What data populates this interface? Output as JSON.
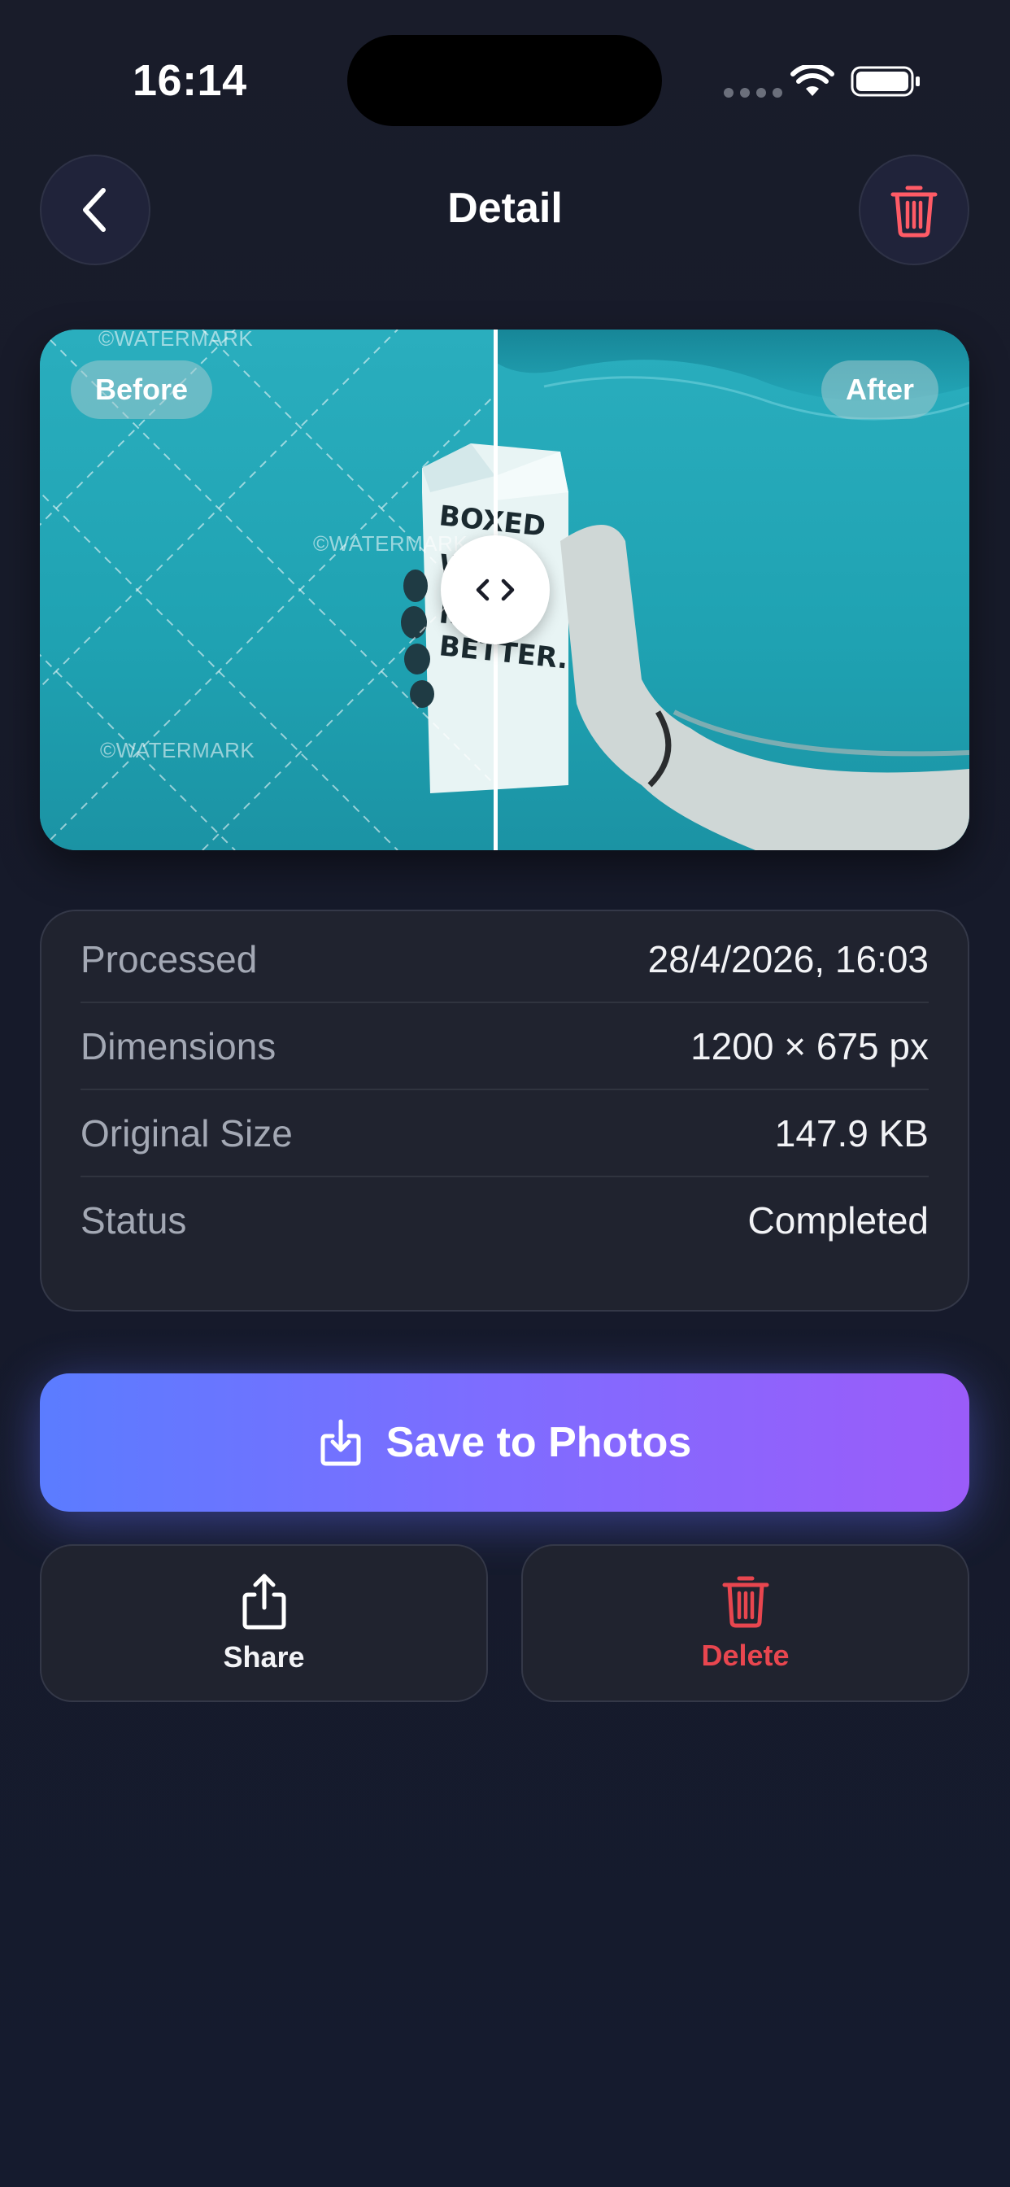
{
  "status_bar": {
    "time": "16:14"
  },
  "header": {
    "title": "Detail",
    "back_icon": "chevron-left-icon",
    "trash_icon": "trash-icon"
  },
  "compare": {
    "before_label": "Before",
    "after_label": "After",
    "watermark": "©WATERMARK",
    "handle_icon": "left-right-arrows-icon",
    "split_fraction": 0.49
  },
  "info": {
    "rows": [
      {
        "label": "Processed",
        "value": "28/4/2026, 16:03"
      },
      {
        "label": "Dimensions",
        "value": "1200 × 675 px"
      },
      {
        "label": "Original Size",
        "value": "147.9 KB"
      },
      {
        "label": "Status",
        "value": "Completed"
      }
    ]
  },
  "actions": {
    "save_label": "Save to Photos",
    "share_label": "Share",
    "delete_label": "Delete"
  },
  "colors": {
    "background": "#181b2a",
    "card": "#20232f",
    "accent_start": "#5b7cff",
    "accent_end": "#9b5cf9",
    "danger": "#e8464f"
  }
}
